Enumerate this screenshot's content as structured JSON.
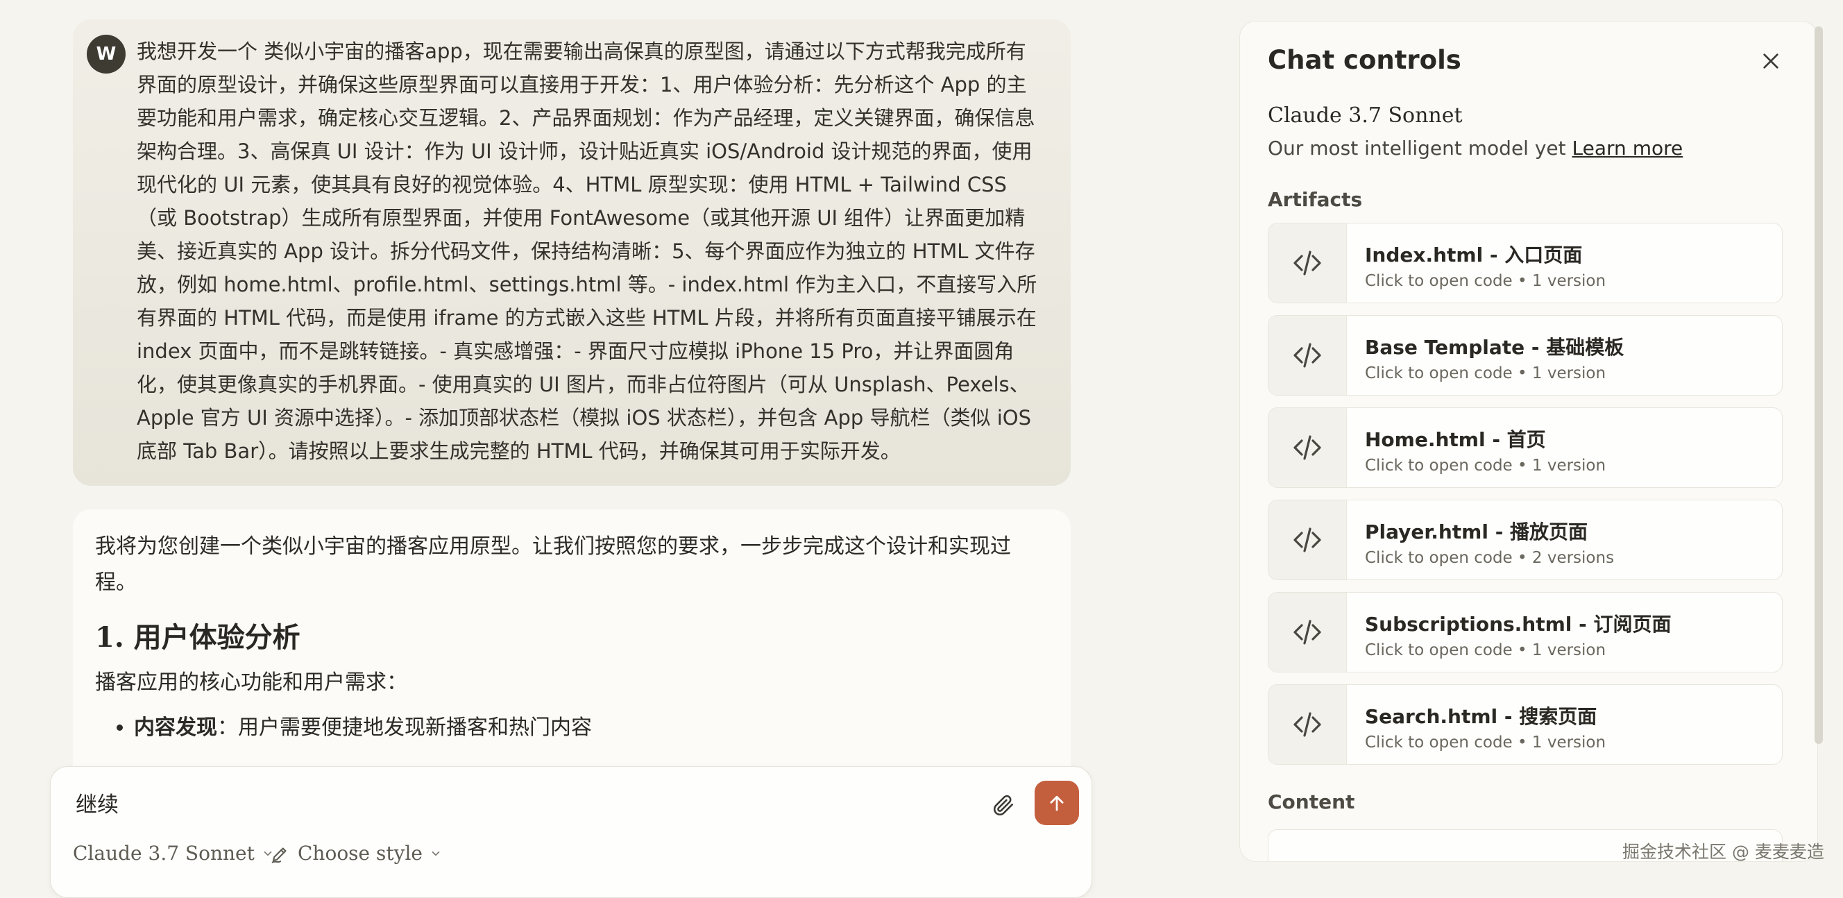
{
  "user_message": {
    "avatar_letter": "W",
    "text": "我想开发一个 类似小宇宙的播客app，现在需要输出高保真的原型图，请通过以下方式帮我完成所有界面的原型设计，并确保这些原型界面可以直接用于开发：1、用户体验分析：先分析这个 App 的主要功能和用户需求，确定核心交互逻辑。2、产品界面规划：作为产品经理，定义关键界面，确保信息架构合理。3、高保真 UI 设计：作为 UI 设计师，设计贴近真实 iOS/Android 设计规范的界面，使用现代化的 UI 元素，使其具有良好的视觉体验。4、HTML 原型实现：使用 HTML + Tailwind CSS（或 Bootstrap）生成所有原型界面，并使用 FontAwesome（或其他开源 UI 组件）让界面更加精美、接近真实的 App 设计。拆分代码文件，保持结构清晰：5、每个界面应作为独立的 HTML 文件存放，例如 home.html、profile.html、settings.html 等。- index.html 作为主入口，不直接写入所有界面的 HTML 代码，而是使用 iframe 的方式嵌入这些 HTML 片段，并将所有页面直接平铺展示在 index 页面中，而不是跳转链接。- 真实感增强：- 界面尺寸应模拟 iPhone 15 Pro，并让界面圆角化，使其更像真实的手机界面。- 使用真实的 UI 图片，而非占位符图片（可从 Unsplash、Pexels、Apple 官方 UI 资源中选择）。- 添加顶部状态栏（模拟 iOS 状态栏），并包含 App 导航栏（类似 iOS 底部 Tab Bar）。请按照以上要求生成完整的 HTML 代码，并确保其可用于实际开发。"
  },
  "assistant_message": {
    "intro": "我将为您创建一个类似小宇宙的播客应用原型。让我们按照您的要求，一步步完成这个设计和实现过程。",
    "heading": "1. 用户体验分析",
    "paragraph": "播客应用的核心功能和用户需求：",
    "bullets": [
      {
        "term": "内容发现",
        "sep": "：",
        "desc": "用户需要便捷地发现新播客和热门内容"
      }
    ]
  },
  "composer": {
    "input_value": "继续",
    "model_label": "Claude 3.7 Sonnet",
    "style_label": "Choose style"
  },
  "panel": {
    "title": "Chat controls",
    "model_name": "Claude 3.7 Sonnet",
    "model_desc": "Our most intelligent model yet",
    "learn_more": "Learn more",
    "artifacts_label": "Artifacts",
    "content_label": "Content",
    "artifacts": [
      {
        "title": "Index.html - 入口页面",
        "subtitle": "Click to open code • 1 version"
      },
      {
        "title": "Base Template - 基础模板",
        "subtitle": "Click to open code • 1 version"
      },
      {
        "title": "Home.html - 首页",
        "subtitle": "Click to open code • 1 version"
      },
      {
        "title": "Player.html - 播放页面",
        "subtitle": "Click to open code • 2 versions"
      },
      {
        "title": "Subscriptions.html - 订阅页面",
        "subtitle": "Click to open code • 1 version"
      },
      {
        "title": "Search.html - 搜索页面",
        "subtitle": "Click to open code • 1 version"
      }
    ]
  },
  "watermark": "掘金技术社区 @ 麦麦麦造",
  "colors": {
    "accent": "#c45f3d",
    "background": "#f5f4ee",
    "avatar": "#3e3b33"
  }
}
